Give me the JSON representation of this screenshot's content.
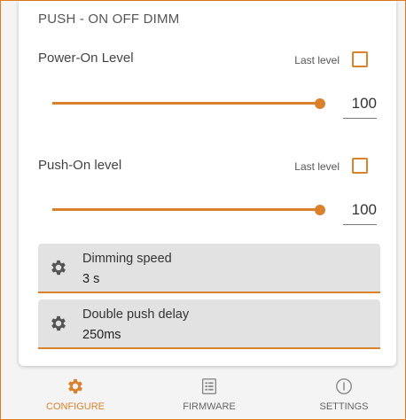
{
  "section_title": "PUSH - ON OFF DIMM",
  "power_on": {
    "label": "Power-On Level",
    "last_level_label": "Last level",
    "last_level_checked": false,
    "value": "100",
    "slider_fraction": 1.0
  },
  "push_on": {
    "label": "Push-On level",
    "last_level_label": "Last level",
    "last_level_checked": false,
    "value": "100",
    "slider_fraction": 1.0
  },
  "dimming_speed": {
    "title": "Dimming speed",
    "value": "3 s"
  },
  "double_push_delay": {
    "title": "Double push delay",
    "value": "250ms"
  },
  "nav": {
    "configure": "CONFIGURE",
    "firmware": "FIRMWARE",
    "settings": "SETTINGS",
    "active": "configure"
  },
  "colors": {
    "accent": "#d9822b",
    "card_bg": "#e2e2e2"
  },
  "icons": [
    "gear-icon",
    "firmware-icon",
    "info-icon"
  ]
}
